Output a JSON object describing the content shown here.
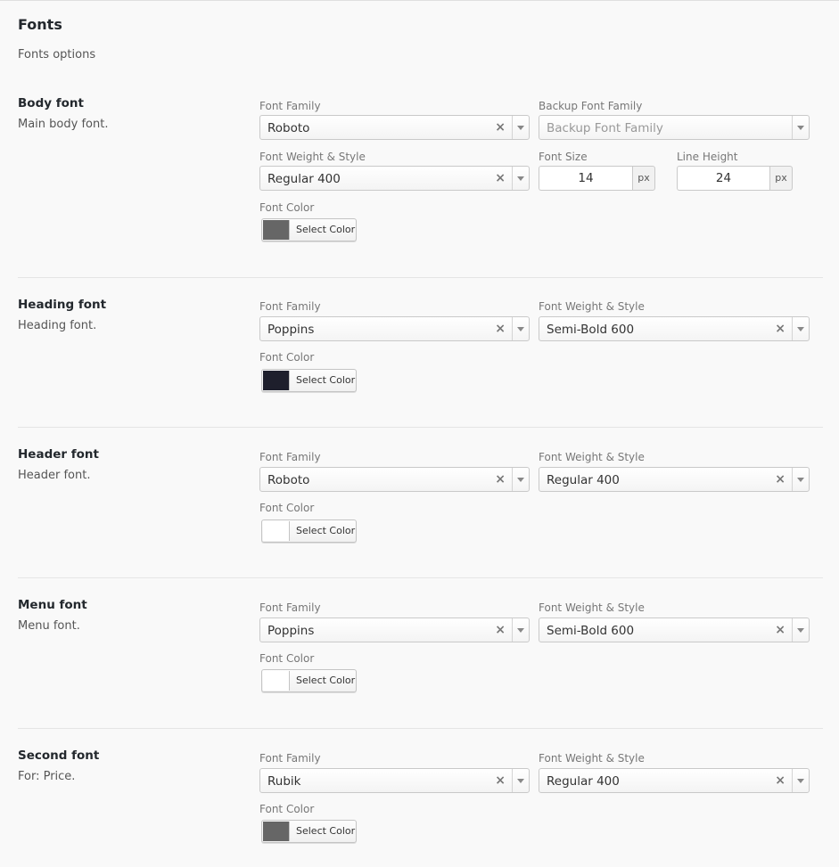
{
  "panel": {
    "title": "Fonts",
    "subtitle": "Fonts options"
  },
  "labels": {
    "font_family": "Font Family",
    "backup_font_family": "Backup Font Family",
    "font_weight_style": "Font Weight & Style",
    "font_size": "Font Size",
    "line_height": "Line Height",
    "font_color": "Font Color",
    "select_color": "Select Color",
    "unit": "px"
  },
  "clear_glyph": "×",
  "body_font": {
    "title": "Body font",
    "description": "Main body font.",
    "family": "Roboto",
    "backup_placeholder": "Backup Font Family",
    "weight": "Regular 400",
    "size": "14",
    "line_height": "24",
    "color": "#666666"
  },
  "heading_font": {
    "title": "Heading font",
    "description": "Heading font.",
    "family": "Poppins",
    "weight": "Semi-Bold 600",
    "color": "#1e1f2c"
  },
  "header_font": {
    "title": "Header font",
    "description": "Header font.",
    "family": "Roboto",
    "weight": "Regular 400",
    "color": "#ffffff"
  },
  "menu_font": {
    "title": "Menu font",
    "description": "Menu font.",
    "family": "Poppins",
    "weight": "Semi-Bold 600",
    "color": "#ffffff"
  },
  "second_font": {
    "title": "Second font",
    "description": "For: Price.",
    "family": "Rubik",
    "weight": "Regular 400",
    "color": "#666666"
  }
}
